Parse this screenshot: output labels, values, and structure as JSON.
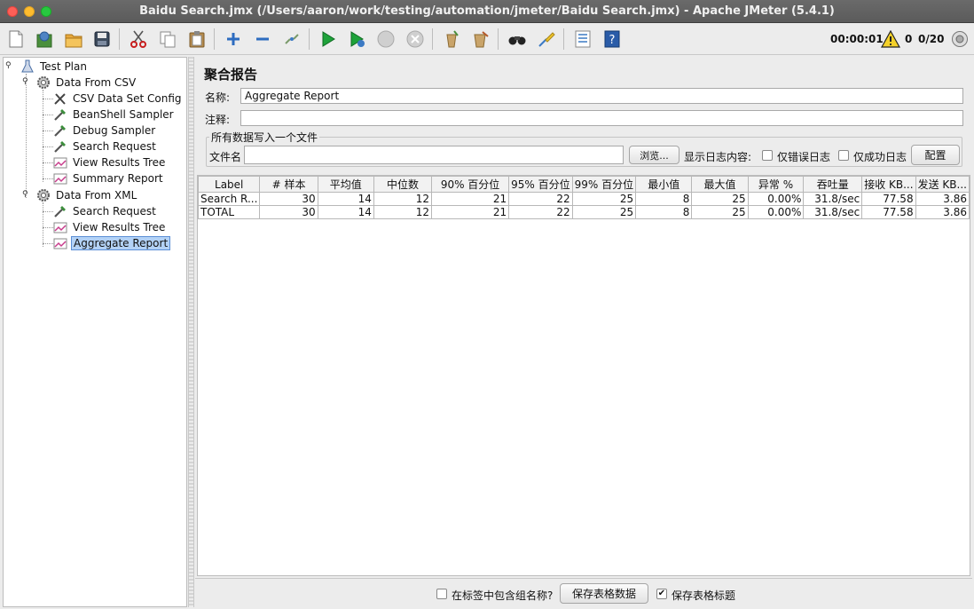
{
  "window": {
    "title": "Baidu Search.jmx (/Users/aaron/work/testing/automation/jmeter/Baidu Search.jmx) - Apache JMeter (5.4.1)"
  },
  "toolbar": {
    "icons": [
      "new-icon",
      "templates-icon",
      "open-icon",
      "save-icon",
      "cut-icon",
      "copy-icon",
      "paste-icon",
      "expand-icon",
      "collapse-icon",
      "toggle-icon",
      "start-icon",
      "start-no-pause-icon",
      "stop-icon",
      "shutdown-icon",
      "clear-icon",
      "clear-all-icon",
      "search-icon",
      "reset-search-icon",
      "function-helper-icon",
      "help-icon"
    ],
    "timer": "00:00:01",
    "error_count": "0",
    "threads": "0/20"
  },
  "tree": {
    "nodes": [
      {
        "label": "Test Plan",
        "icon": "test-plan-icon"
      },
      {
        "label": "Data From CSV",
        "icon": "thread-group-gear-icon"
      },
      {
        "label": "CSV Data Set Config",
        "icon": "config-tools-icon"
      },
      {
        "label": "BeanShell Sampler",
        "icon": "sampler-pipette-icon"
      },
      {
        "label": "Debug Sampler",
        "icon": "sampler-pipette-icon"
      },
      {
        "label": "Search Request",
        "icon": "sampler-pipette-icon"
      },
      {
        "label": "View Results Tree",
        "icon": "listener-chart-icon"
      },
      {
        "label": "Summary Report",
        "icon": "listener-chart-icon"
      },
      {
        "label": "Data From XML",
        "icon": "thread-group-gear-icon"
      },
      {
        "label": "Search Request",
        "icon": "sampler-pipette-icon"
      },
      {
        "label": "View Results Tree",
        "icon": "listener-chart-icon"
      },
      {
        "label": "Aggregate Report",
        "icon": "listener-chart-icon"
      }
    ]
  },
  "panel": {
    "title": "聚合报告",
    "name_label": "名称:",
    "name_value": "Aggregate Report",
    "comment_label": "注释:",
    "comment_value": "",
    "group_title": "所有数据写入一个文件",
    "filename_label": "文件名",
    "filename_value": "",
    "browse_label": "浏览...",
    "log_label": "显示日志内容:",
    "errors_only_label": "仅错误日志",
    "success_only_label": "仅成功日志",
    "configure_label": "配置"
  },
  "table": {
    "headers": [
      "Label",
      "# 样本",
      "平均值",
      "中位数",
      "90% 百分位",
      "95% 百分位",
      "99% 百分位",
      "最小值",
      "最大值",
      "异常 %",
      "吞吐量",
      "接收 KB...",
      "发送 KB..."
    ],
    "rows": [
      [
        "Search R...",
        "30",
        "14",
        "12",
        "21",
        "22",
        "25",
        "8",
        "25",
        "0.00%",
        "31.8/sec",
        "77.58",
        "3.86"
      ],
      [
        "TOTAL",
        "30",
        "14",
        "12",
        "21",
        "22",
        "25",
        "8",
        "25",
        "0.00%",
        "31.8/sec",
        "77.58",
        "3.86"
      ]
    ]
  },
  "bottom": {
    "include_group_label": "在标签中包含组名称?",
    "include_group_checked": false,
    "save_data_label": "保存表格数据",
    "save_header_label": "保存表格标题",
    "save_header_checked": true
  }
}
